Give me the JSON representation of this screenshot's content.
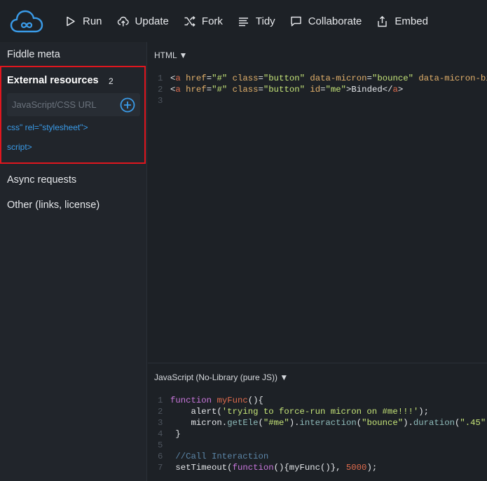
{
  "toolbar": {
    "run": "Run",
    "update": "Update",
    "fork": "Fork",
    "tidy": "Tidy",
    "collaborate": "Collaborate",
    "embed": "Embed"
  },
  "sidebar": {
    "fiddle_meta": "Fiddle meta",
    "external_resources": {
      "title": "External resources",
      "count": "2",
      "input_placeholder": "JavaScript/CSS URL",
      "items": [
        "css\" rel=\"stylesheet\">",
        "script>"
      ]
    },
    "async_requests": "Async requests",
    "other": "Other (links, license)"
  },
  "html_panel": {
    "label": "HTML ▼",
    "lines": [
      {
        "n": "1",
        "segments": [
          {
            "c": "",
            "t": "<"
          },
          {
            "c": "tg",
            "t": "a"
          },
          {
            "c": "",
            "t": " "
          },
          {
            "c": "at",
            "t": "href"
          },
          {
            "c": "",
            "t": "="
          },
          {
            "c": "st",
            "t": "\"#\""
          },
          {
            "c": "",
            "t": " "
          },
          {
            "c": "at",
            "t": "class"
          },
          {
            "c": "",
            "t": "="
          },
          {
            "c": "st",
            "t": "\"button\""
          },
          {
            "c": "",
            "t": " "
          },
          {
            "c": "at",
            "t": "data-micron"
          },
          {
            "c": "",
            "t": "="
          },
          {
            "c": "st",
            "t": "\"bounce\""
          },
          {
            "c": "",
            "t": " "
          },
          {
            "c": "at",
            "t": "data-micron-bi"
          }
        ]
      },
      {
        "n": "2",
        "segments": [
          {
            "c": "",
            "t": "<"
          },
          {
            "c": "tg",
            "t": "a"
          },
          {
            "c": "",
            "t": " "
          },
          {
            "c": "at",
            "t": "href"
          },
          {
            "c": "",
            "t": "="
          },
          {
            "c": "st",
            "t": "\"#\""
          },
          {
            "c": "",
            "t": " "
          },
          {
            "c": "at",
            "t": "class"
          },
          {
            "c": "",
            "t": "="
          },
          {
            "c": "st",
            "t": "\"button\""
          },
          {
            "c": "",
            "t": " "
          },
          {
            "c": "at",
            "t": "id"
          },
          {
            "c": "",
            "t": "="
          },
          {
            "c": "st",
            "t": "\"me\""
          },
          {
            "c": "",
            "t": ">Binded</"
          },
          {
            "c": "tg",
            "t": "a"
          },
          {
            "c": "",
            "t": ">"
          }
        ]
      },
      {
        "n": "3",
        "segments": []
      }
    ]
  },
  "js_panel": {
    "label": "JavaScript (No-Library (pure JS)) ▼",
    "lines": [
      {
        "n": "1",
        "segments": [
          {
            "c": "kw",
            "t": "function"
          },
          {
            "c": "",
            "t": " "
          },
          {
            "c": "nm",
            "t": "myFunc"
          },
          {
            "c": "",
            "t": "(){"
          }
        ]
      },
      {
        "n": "2",
        "segments": [
          {
            "c": "",
            "t": "    alert("
          },
          {
            "c": "st",
            "t": "'trying to force-run micron on #me!!!'"
          },
          {
            "c": "",
            "t": ");"
          }
        ]
      },
      {
        "n": "3",
        "segments": [
          {
            "c": "",
            "t": "    micron."
          },
          {
            "c": "fn",
            "t": "getEle"
          },
          {
            "c": "",
            "t": "("
          },
          {
            "c": "st",
            "t": "\"#me\""
          },
          {
            "c": "",
            "t": ")."
          },
          {
            "c": "fn",
            "t": "interaction"
          },
          {
            "c": "",
            "t": "("
          },
          {
            "c": "st",
            "t": "\"bounce\""
          },
          {
            "c": "",
            "t": ")."
          },
          {
            "c": "fn",
            "t": "duration"
          },
          {
            "c": "",
            "t": "("
          },
          {
            "c": "st",
            "t": "\".45\""
          },
          {
            "c": "",
            "t": ")"
          }
        ]
      },
      {
        "n": "4",
        "segments": [
          {
            "c": "",
            "t": " }"
          }
        ]
      },
      {
        "n": "5",
        "segments": []
      },
      {
        "n": "6",
        "segments": [
          {
            "c": "cm",
            "t": " //Call Interaction"
          }
        ]
      },
      {
        "n": "7",
        "segments": [
          {
            "c": "",
            "t": " setTimeout("
          },
          {
            "c": "kw",
            "t": "function"
          },
          {
            "c": "",
            "t": "(){myFunc()}, "
          },
          {
            "c": "nm",
            "t": "5000"
          },
          {
            "c": "",
            "t": ");"
          }
        ]
      }
    ]
  }
}
